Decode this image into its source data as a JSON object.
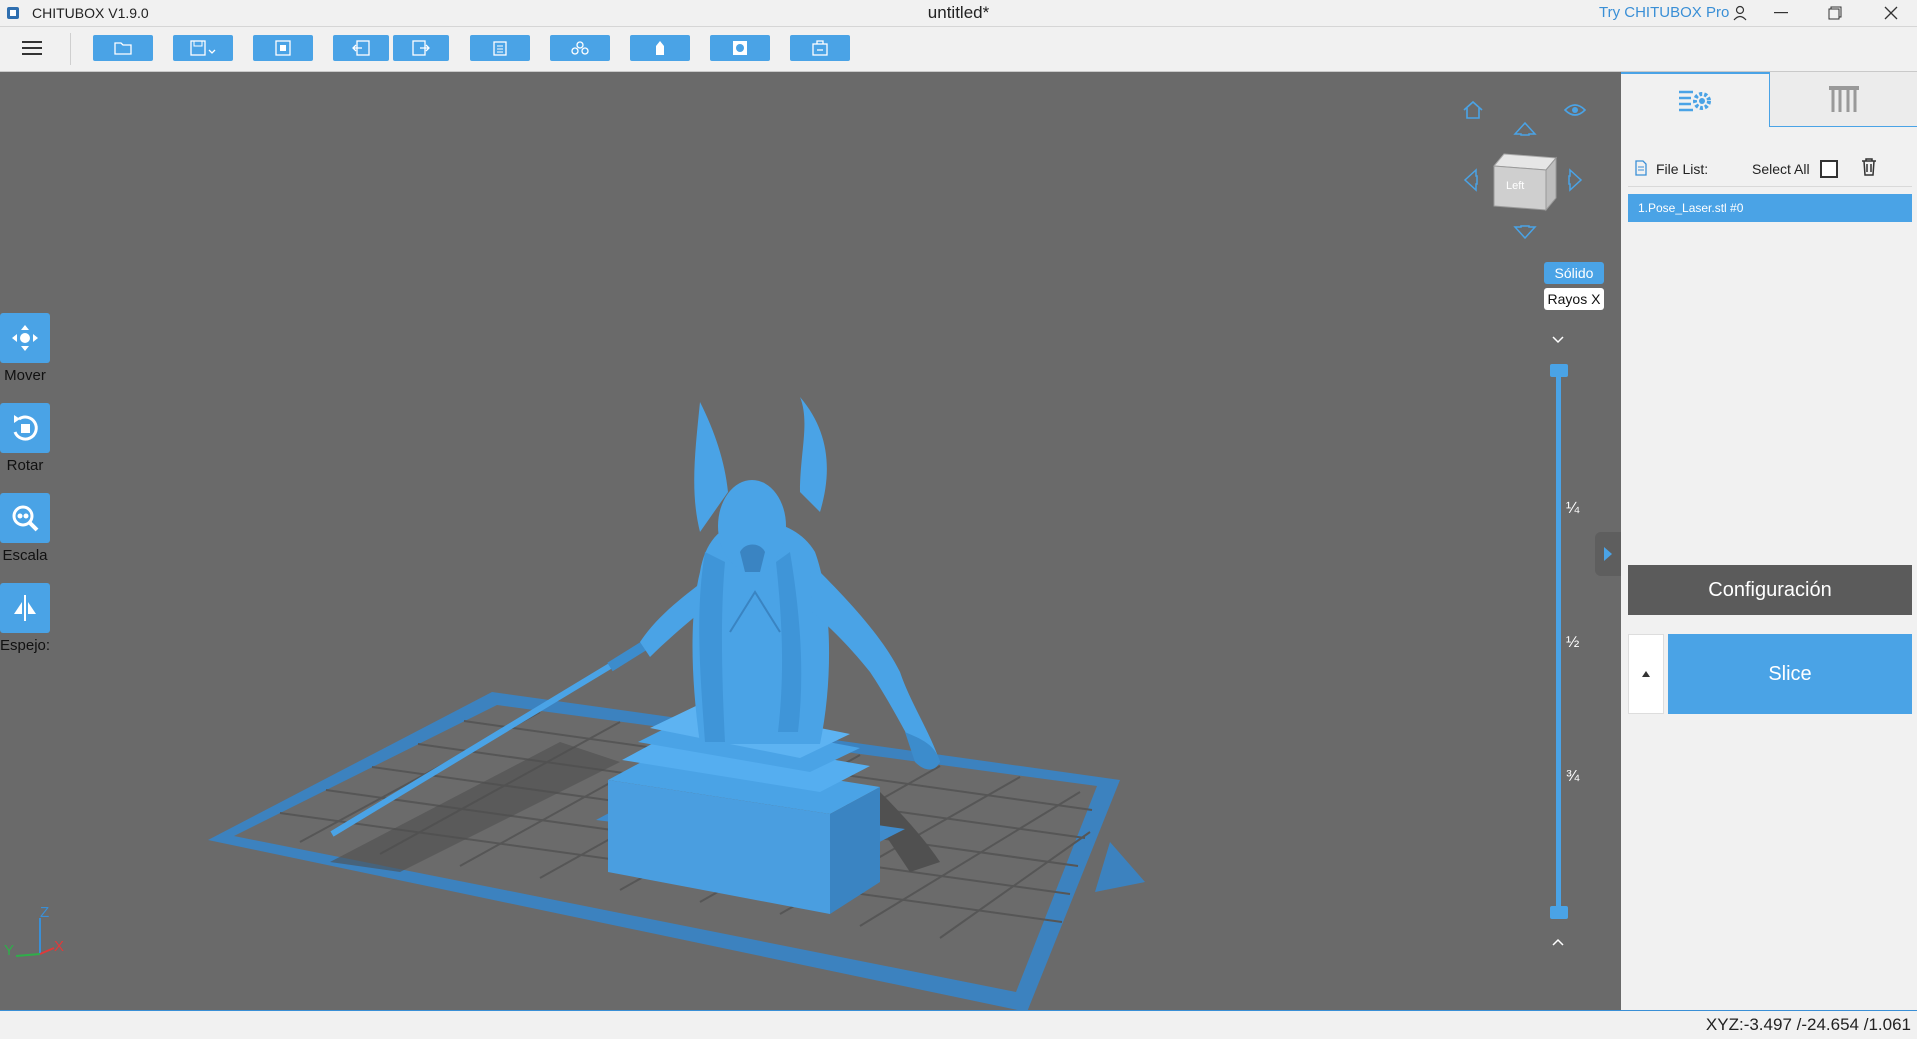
{
  "app": {
    "name": "CHITUBOX V1.9.0",
    "doc_title": "untitled*",
    "try_pro": "Try CHITUBOX Pro"
  },
  "toolbar": {
    "buttons": [
      "open-file",
      "save-file",
      "auto-layout",
      "undo",
      "redo",
      "copy",
      "multiply",
      "support",
      "hollow",
      "dig-hole"
    ]
  },
  "left_tools": [
    {
      "label": "Mover",
      "icon": "move-icon"
    },
    {
      "label": "Rotar",
      "icon": "rotate-icon"
    },
    {
      "label": "Escala",
      "icon": "scale-icon"
    },
    {
      "label": "Espejo:",
      "icon": "mirror-icon"
    }
  ],
  "view_cube": {
    "face": "Left"
  },
  "render_modes": {
    "solid": "Sólido",
    "xray": "Rayos X",
    "active": "Sólido"
  },
  "layer_slider": {
    "marks": [
      "¼",
      "½",
      "¾"
    ]
  },
  "axis": {
    "z": "Z",
    "y": "Y",
    "x": "X"
  },
  "right_panel": {
    "file_list_label": "File List:",
    "select_all_label": "Select All",
    "files": [
      "1.Pose_Laser.stl #0"
    ],
    "config_label": "Configuración",
    "slice_label": "Slice"
  },
  "status": {
    "coords": "XYZ:-3.497 /-24.654 /1.061"
  },
  "colors": {
    "accent": "#4aa3e6",
    "viewport": "#6a6a6a",
    "model": "#4aa3e6"
  }
}
